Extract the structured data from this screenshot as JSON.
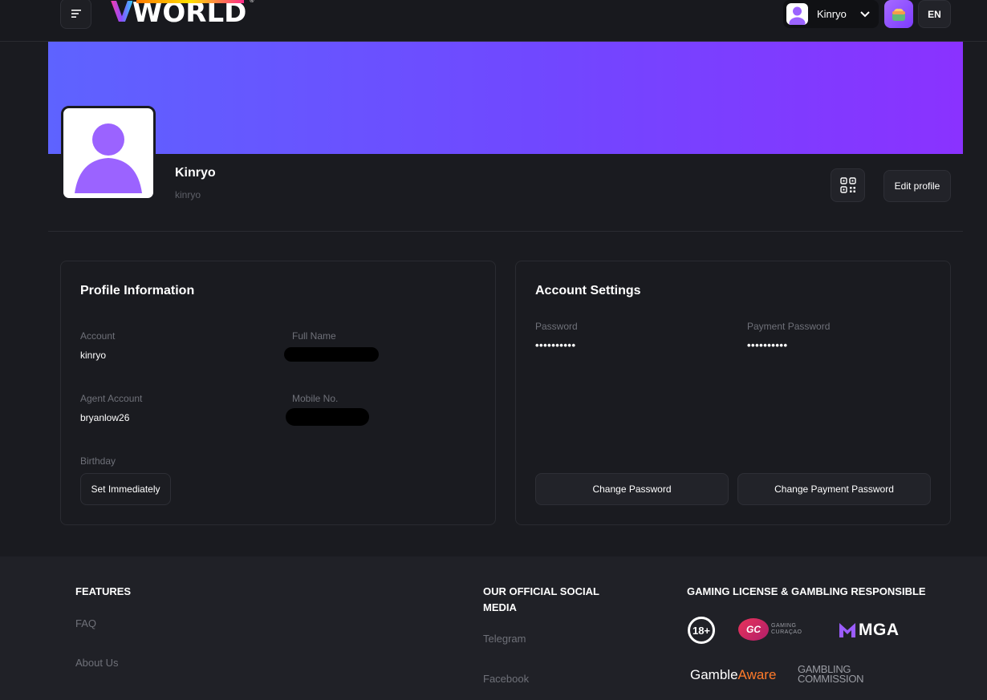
{
  "header": {
    "logo_text": "WORLD",
    "logo_v": "V",
    "logo_reg": "®",
    "user_name": "Kinryo",
    "lang": "EN"
  },
  "profile": {
    "name": "Kinryo",
    "username": "kinryo",
    "edit_label": "Edit profile"
  },
  "profile_info": {
    "title": "Profile Information",
    "account_label": "Account",
    "account_value": "kinryo",
    "full_name_label": "Full Name",
    "agent_label": "Agent Account",
    "agent_value": "bryanlow26",
    "mobile_label": "Mobile No.",
    "birthday_label": "Birthday",
    "birthday_button": "Set Immediately"
  },
  "account_settings": {
    "title": "Account Settings",
    "password_label": "Password",
    "password_value": "••••••••••",
    "payment_password_label": "Payment Password",
    "payment_password_value": "••••••••••",
    "change_password": "Change Password",
    "change_payment_password": "Change Payment Password"
  },
  "footer": {
    "features_title": "FEATURES",
    "features_links": [
      "FAQ",
      "About Us"
    ],
    "social_title_1": "OUR OFFICIAL SOCIAL",
    "social_title_2": "MEDIA",
    "social_links": [
      "Telegram",
      "Facebook"
    ],
    "license_title": "GAMING LICENSE & GAMBLING RESPONSIBLE",
    "badge_18": "18+",
    "gc_mark": "GC",
    "gc_text_1": "GAMING",
    "gc_text_2": "CURAÇAO",
    "mga": "MGA",
    "gamble": "Gamble",
    "aware": "Aware",
    "gambling_1": "GAMBLING",
    "gambling_2": "COMMISSION"
  },
  "colors": {
    "banner_start": "#5e63ff",
    "banner_end": "#8a32ff",
    "avatar_purple": "#9b63ff",
    "background": "#1a1b20"
  }
}
